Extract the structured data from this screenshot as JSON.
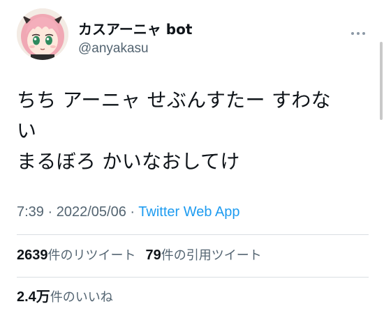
{
  "account": {
    "display_name": "カスアーニャ bot",
    "handle": "@anyakasu",
    "avatar_icon": "anime-girl-avatar-icon",
    "more_icon": "more-options-icon"
  },
  "tweet": {
    "lines": [
      "ちち アーニャ せぶんすたー すわな",
      "い",
      "まるぼろ かいなおしてけ"
    ],
    "time": "7:39",
    "separator": "·",
    "date": "2022/05/06",
    "source": "Twitter Web App"
  },
  "stats": {
    "retweets_count": "2639",
    "retweets_label": "件のリツイート",
    "quotes_count": "79",
    "quotes_label": "件の引用ツイート",
    "likes_count": "2.4万",
    "likes_label": "件のいいね"
  },
  "colors": {
    "text": "#0f1419",
    "secondary": "#536471",
    "link": "#1d9bf0",
    "divider": "#d9dee2"
  }
}
